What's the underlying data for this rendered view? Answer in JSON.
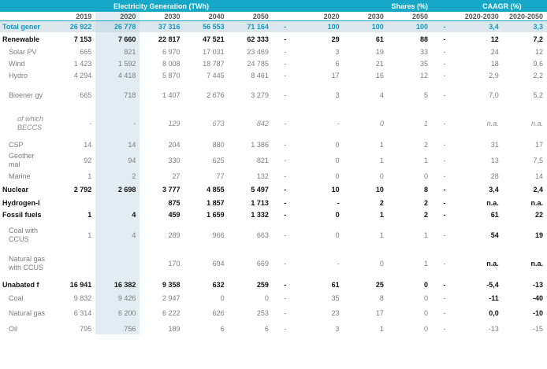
{
  "header": {
    "generation_title": "Electricity Generation (TWh)",
    "shares_title": "Shares (%)",
    "cagr_title": "CAAGR (%)"
  },
  "years": {
    "gen": [
      "2019",
      "2020",
      "2030",
      "2040",
      "2050"
    ],
    "shares": [
      "2020",
      "2030",
      "2050"
    ],
    "cagr": [
      "2020-2030",
      "2020-2050"
    ]
  },
  "rows": [
    {
      "label": "Total gener",
      "kind": "total",
      "gen": [
        "26 922",
        "26 778",
        "37 316",
        "56 553",
        "71 164"
      ],
      "dash1": "-",
      "shares": [
        "100",
        "100",
        "100"
      ],
      "dash2": "-",
      "cagr": [
        "3,4",
        "3,3"
      ]
    },
    {
      "label": "Renewable",
      "kind": "main",
      "gen": [
        "7 153",
        "7 660",
        "22 817",
        "47 521",
        "62 333"
      ],
      "dash1": "-",
      "shares": [
        "29",
        "61",
        "88"
      ],
      "dash2": "-",
      "cagr": [
        "12",
        "7,2"
      ]
    },
    {
      "label": "Solar PV",
      "kind": "sub",
      "gen": [
        "665",
        "821",
        "6 970",
        "17 031",
        "23 469"
      ],
      "dash1": "-",
      "shares": [
        "3",
        "19",
        "33"
      ],
      "dash2": "-",
      "cagr": [
        "24",
        "12"
      ]
    },
    {
      "label": "Wind",
      "kind": "sub",
      "gen": [
        "1 423",
        "1 592",
        "8 008",
        "18 787",
        "24 785"
      ],
      "dash1": "-",
      "shares": [
        "6",
        "21",
        "35"
      ],
      "dash2": "-",
      "cagr": [
        "18",
        "9,6"
      ]
    },
    {
      "label": "Hydro",
      "kind": "sub",
      "gen": [
        "4 294",
        "4 418",
        "5 870",
        "7 445",
        "8 461"
      ],
      "dash1": "-",
      "shares": [
        "17",
        "16",
        "12"
      ],
      "dash2": "-",
      "cagr": [
        "2,9",
        "2,2"
      ]
    },
    {
      "label": "Bioener gy",
      "kind": "sub",
      "gen": [
        "665",
        "718",
        "1 407",
        "2 676",
        "3 279"
      ],
      "dash1": "-",
      "shares": [
        "3",
        "4",
        "5"
      ],
      "dash2": "-",
      "cagr": [
        "7,0",
        "5,2"
      ]
    },
    {
      "label": "of which BECCS",
      "kind": "subsub",
      "gen": [
        "-",
        "-",
        "129",
        "673",
        "842"
      ],
      "dash1": "-",
      "shares": [
        "-",
        "0",
        "1"
      ],
      "dash2": "-",
      "cagr": [
        "n.a.",
        "n.a."
      ]
    },
    {
      "label": "CSP",
      "kind": "sub",
      "gen": [
        "14",
        "14",
        "204",
        "880",
        "1 386"
      ],
      "dash1": "-",
      "shares": [
        "0",
        "1",
        "2"
      ],
      "dash2": "-",
      "cagr": [
        "31",
        "17"
      ]
    },
    {
      "label": "Geother mal",
      "kind": "sub",
      "gen": [
        "92",
        "94",
        "330",
        "625",
        "821"
      ],
      "dash1": "-",
      "shares": [
        "0",
        "1",
        "1"
      ],
      "dash2": "-",
      "cagr": [
        "13",
        "7,5"
      ]
    },
    {
      "label": "Marine",
      "kind": "sub",
      "gen": [
        "1",
        "2",
        "27",
        "77",
        "132"
      ],
      "dash1": "-",
      "shares": [
        "0",
        "0",
        "0"
      ],
      "dash2": "-",
      "cagr": [
        "28",
        "14"
      ]
    },
    {
      "label": "Nuclear",
      "kind": "main",
      "gen": [
        "2 792",
        "2 698",
        "3 777",
        "4 855",
        "5 497"
      ],
      "dash1": "-",
      "shares": [
        "10",
        "10",
        "8"
      ],
      "dash2": "-",
      "cagr": [
        "3,4",
        "2,4"
      ]
    },
    {
      "label": "Hydrogen-l",
      "kind": "main",
      "gen": [
        "",
        "",
        "875",
        "1 857",
        "1 713"
      ],
      "dash1": "-",
      "shares": [
        "-",
        "2",
        "2"
      ],
      "dash2": "-",
      "cagr": [
        "n.a.",
        "n.a."
      ]
    },
    {
      "label": "Fossil fuels",
      "kind": "main",
      "gen": [
        "1",
        "4",
        "459",
        "1 659",
        "1 332"
      ],
      "dash1": "-",
      "shares": [
        "0",
        "1",
        "2"
      ],
      "dash2": "-",
      "cagr": [
        "61",
        "22"
      ]
    },
    {
      "label": "Coal with CCUS",
      "kind": "sub",
      "gen": [
        "1",
        "4",
        "289",
        "966",
        "663"
      ],
      "dash1": "-",
      "shares": [
        "0",
        "1",
        "1"
      ],
      "dash2": "-",
      "cagr": [
        "54",
        "19"
      ],
      "cagr_bold": true
    },
    {
      "label": "Natural gas with CCUS",
      "kind": "sub",
      "gen": [
        "",
        "",
        "170",
        "694",
        "669"
      ],
      "dash1": "-",
      "shares": [
        "-",
        "0",
        "1"
      ],
      "dash2": "-",
      "cagr": [
        "n.a.",
        "n.a."
      ],
      "cagr_bold": true
    },
    {
      "label": "Unabated f",
      "kind": "main",
      "gen": [
        "16 941",
        "16 382",
        "9 358",
        "632",
        "259"
      ],
      "dash1": "-",
      "shares": [
        "61",
        "25",
        "0"
      ],
      "dash2": "-",
      "cagr": [
        "-5,4",
        "-13"
      ]
    },
    {
      "label": "Coal",
      "kind": "sub",
      "gen": [
        "9 832",
        "9 426",
        "2 947",
        "0",
        "0"
      ],
      "dash1": "-",
      "shares": [
        "35",
        "8",
        "0"
      ],
      "dash2": "-",
      "cagr": [
        "-11",
        "-40"
      ],
      "cagr_bold": true
    },
    {
      "label": "Natural gas",
      "kind": "sub",
      "gen": [
        "6 314",
        "6 200",
        "6 222",
        "626",
        "253"
      ],
      "dash1": "-",
      "shares": [
        "23",
        "17",
        "0"
      ],
      "dash2": "-",
      "cagr": [
        "0,0",
        "-10"
      ],
      "cagr_bold": true
    },
    {
      "label": "Oil",
      "kind": "sub",
      "gen": [
        "795",
        "756",
        "189",
        "6",
        "6"
      ],
      "dash1": "-",
      "shares": [
        "3",
        "1",
        "0"
      ],
      "dash2": "-",
      "cagr": [
        "-13",
        "-15"
      ]
    }
  ]
}
